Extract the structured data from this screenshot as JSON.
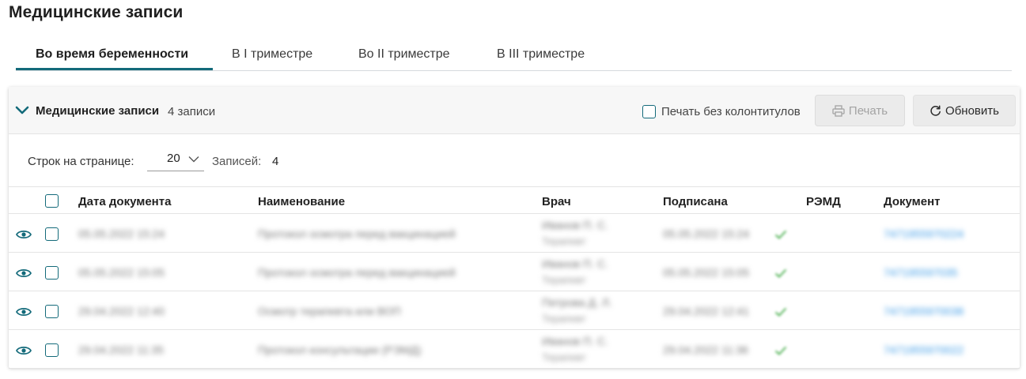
{
  "page": {
    "title": "Медицинские записи"
  },
  "tabs": [
    {
      "label": "Во время беременности",
      "active": true
    },
    {
      "label": "В I триместре",
      "active": false
    },
    {
      "label": "Во II триместре",
      "active": false
    },
    {
      "label": "В III триместре",
      "active": false
    }
  ],
  "panel": {
    "title": "Медицинские записи",
    "count": "4 записи",
    "print_no_headers_label": "Печать без колонтитулов",
    "print_label": "Печать",
    "refresh_label": "Обновить"
  },
  "pager": {
    "rows_per_page_label": "Строк на странице:",
    "rows_per_page_value": "20",
    "records_label": "Записей:",
    "records_count": "4"
  },
  "table": {
    "columns": {
      "date": "Дата документа",
      "name": "Наименование",
      "doctor": "Врач",
      "signed": "Подписана",
      "remd": "РЭМД",
      "document": "Документ"
    },
    "rows": [
      {
        "date": "05.05.2022 15:24",
        "name": "Протокол осмотра перед вакцинацией",
        "doctor": "Иванов П. С.",
        "doctor_role": "Терапевт",
        "signed": "05.05.2022 15:24",
        "document": "7471955970224"
      },
      {
        "date": "05.05.2022 15:05",
        "name": "Протокол осмотра перед вакцинацией",
        "doctor": "Иванов П. С.",
        "doctor_role": "Терапевт",
        "signed": "05.05.2022 15:05",
        "document": "747195597035"
      },
      {
        "date": "29.04.2022 12:40",
        "name": "Осмотр терапевта или ВОП",
        "doctor": "Петрова Д. Л.",
        "doctor_role": "Терапевт",
        "signed": "29.04.2022 12:41",
        "document": "7471955970038"
      },
      {
        "date": "29.04.2022 11:35",
        "name": "Протокол консультации (РЭМД)",
        "doctor": "Иванов П. С.",
        "doctor_role": "Терапевт",
        "signed": "29.04.2022 11:36",
        "document": "7471955970022"
      }
    ]
  },
  "colors": {
    "accent": "#136a7a",
    "link": "#3d9be6",
    "check": "#4caf50"
  }
}
